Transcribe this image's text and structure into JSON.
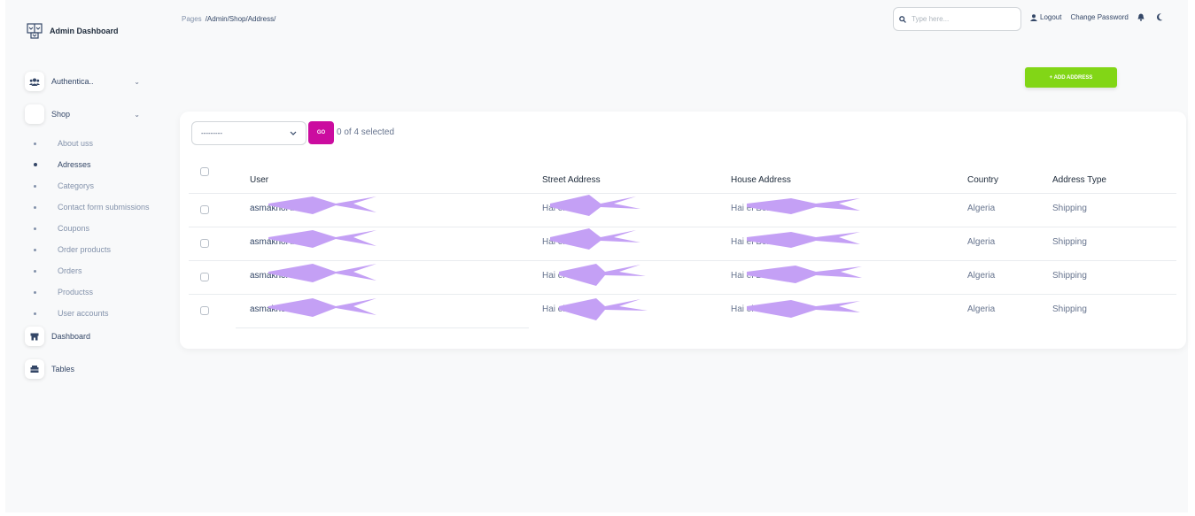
{
  "app": {
    "title": "Admin Dashboard"
  },
  "sidebar": {
    "sections": [
      {
        "label": "Authentica..",
        "icon": "users-icon"
      },
      {
        "label": "Shop",
        "icon": "shop-icon"
      }
    ],
    "shop_items": [
      {
        "label": "About uss",
        "active": false
      },
      {
        "label": "Adresses",
        "active": true
      },
      {
        "label": "Categorys",
        "active": false
      },
      {
        "label": "Contact form submissions",
        "active": false
      },
      {
        "label": "Coupons",
        "active": false
      },
      {
        "label": "Order products",
        "active": false
      },
      {
        "label": "Orders",
        "active": false
      },
      {
        "label": "Productss",
        "active": false
      },
      {
        "label": "User accounts",
        "active": false
      }
    ],
    "bottom": [
      {
        "label": "Dashboard",
        "icon": "store-icon"
      },
      {
        "label": "Tables",
        "icon": "table-icon"
      }
    ]
  },
  "breadcrumb": {
    "prefix": "Pages",
    "path": "/Admin/Shop/Address/"
  },
  "search": {
    "placeholder": "Type here..."
  },
  "top_actions": {
    "logout": "Logout",
    "change_password": "Change Password"
  },
  "add_button": {
    "label": "+ ADD ADDRESS"
  },
  "table_toolbar": {
    "action_value": "---------",
    "go_label": "GO",
    "selected_text": "0 of 4 selected"
  },
  "table": {
    "columns": [
      "User",
      "Street Address",
      "House Address",
      "Country",
      "Address Type"
    ],
    "rows": [
      {
        "user": "asmakhoi        inttledz",
        "street": "Hai el B             18",
        "house": "Hai el Ben               aif",
        "country": "Algeria",
        "type": "Shipping"
      },
      {
        "user": "asmakhoi        inttledz",
        "street": "Hai el B             18",
        "house": "Hai el Ben               aif",
        "country": "Algeria",
        "type": "Shipping"
      },
      {
        "user": "asmakhoi        inttledz",
        "street": "Hai el B",
        "house": "Hai el Ben               aif",
        "country": "Algeria",
        "type": "Shipping"
      },
      {
        "user": "asmakhoci        inttledz",
        "street": "Hai el B",
        "house": "Hai el Ben               aif",
        "country": "Algeria",
        "type": "Shipping"
      }
    ]
  },
  "colors": {
    "accent_green": "#82d616",
    "accent_magenta": "#cb0c9f",
    "redaction": "#c4a0f5"
  }
}
